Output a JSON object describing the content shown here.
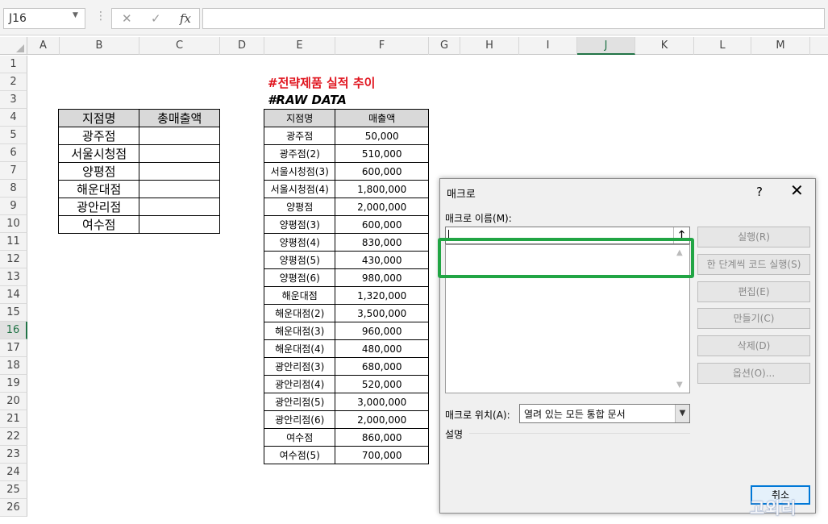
{
  "formula_bar": {
    "name_box": "J16",
    "fx_label": "fx",
    "cancel_glyph": "✕",
    "enter_glyph": "✓",
    "formula": ""
  },
  "columns": [
    "A",
    "B",
    "C",
    "D",
    "E",
    "F",
    "G",
    "H",
    "I",
    "J",
    "K",
    "L",
    "M"
  ],
  "rows": [
    "1",
    "2",
    "3",
    "4",
    "5",
    "6",
    "7",
    "8",
    "9",
    "10",
    "11",
    "12",
    "13",
    "14",
    "15",
    "16",
    "17",
    "18",
    "19",
    "20",
    "21",
    "22",
    "23",
    "24",
    "25",
    "26"
  ],
  "selected_cell": {
    "column": "J",
    "row": "16"
  },
  "summary_table": {
    "headers": [
      "지점명",
      "총매출액"
    ],
    "branches": [
      "광주점",
      "서울시청점",
      "양평점",
      "해운대점",
      "광안리점",
      "여수점"
    ]
  },
  "raw_data": {
    "title": "#전략제품 실적 추이",
    "subtitle": "#RAW DATA",
    "title_color": "#e0141e",
    "headers": [
      "지점명",
      "매출액"
    ],
    "rows": [
      [
        "광주점",
        "50,000"
      ],
      [
        "광주점(2)",
        "510,000"
      ],
      [
        "서울시청점(3)",
        "600,000"
      ],
      [
        "서울시청점(4)",
        "1,800,000"
      ],
      [
        "양평점",
        "2,000,000"
      ],
      [
        "양평점(3)",
        "600,000"
      ],
      [
        "양평점(4)",
        "830,000"
      ],
      [
        "양평점(5)",
        "430,000"
      ],
      [
        "양평점(6)",
        "980,000"
      ],
      [
        "해운대점",
        "1,320,000"
      ],
      [
        "해운대점(2)",
        "3,500,000"
      ],
      [
        "해운대점(3)",
        "960,000"
      ],
      [
        "해운대점(4)",
        "480,000"
      ],
      [
        "광안리점(3)",
        "680,000"
      ],
      [
        "광안리점(4)",
        "520,000"
      ],
      [
        "광안리점(5)",
        "3,000,000"
      ],
      [
        "광안리점(6)",
        "2,000,000"
      ],
      [
        "여수점",
        "860,000"
      ],
      [
        "여수점(5)",
        "700,000"
      ]
    ]
  },
  "dialog": {
    "title": "매크로",
    "help": "?",
    "close": "✕",
    "name_label": "매크로 이름(M):",
    "name_value": "",
    "buttons": [
      "실행(R)",
      "한 단계씩 코드 실행(S)",
      "편집(E)",
      "만들기(C)",
      "삭제(D)",
      "옵션(O)..."
    ],
    "location_label": "매크로 위치(A):",
    "location_value": "열려 있는 모든 통합 문서",
    "description_label": "설명",
    "cancel": "취소",
    "highlight_color": "#21a544"
  },
  "watermark": "고외리"
}
